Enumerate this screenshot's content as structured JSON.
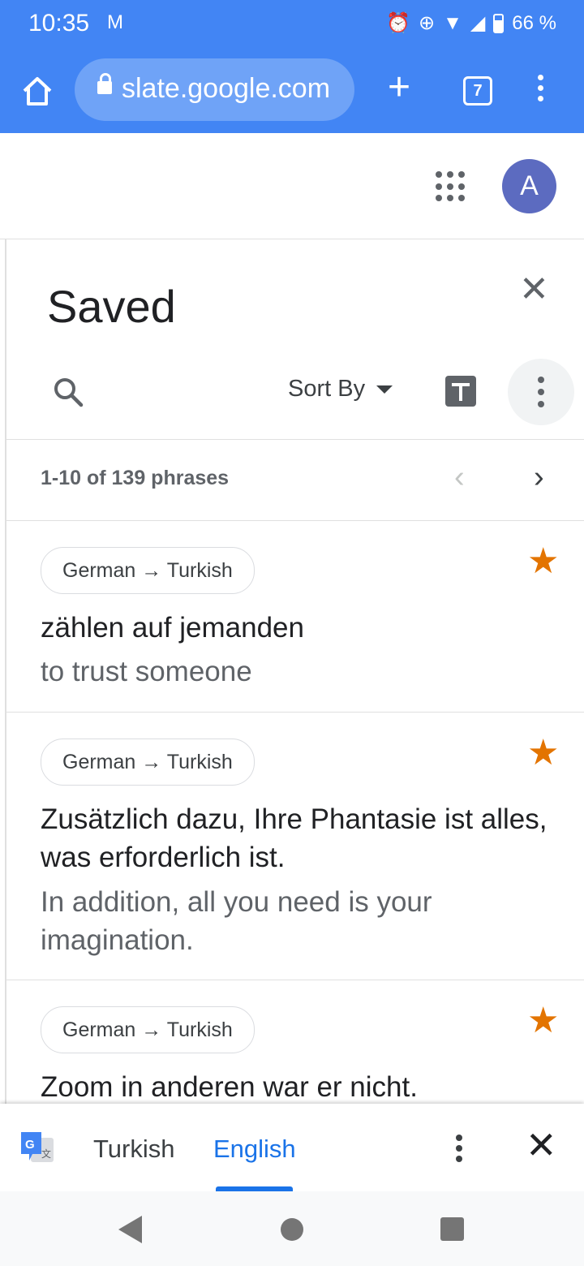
{
  "status_bar": {
    "time": "10:35",
    "mail_icon": "M",
    "battery": "66 %"
  },
  "browser": {
    "url": "slate.google.com",
    "tab_count": "7"
  },
  "header": {
    "avatar_letter": "A"
  },
  "panel": {
    "title": "Saved",
    "sort_label": "Sort By",
    "count_text": "1-10 of 139 phrases"
  },
  "phrases": [
    {
      "lang_pair": "German → Turkish",
      "source": "zählen auf jemanden",
      "target": "to trust someone"
    },
    {
      "lang_pair": "German → Turkish",
      "source": "Zusätzlich dazu, Ihre Phantasie ist alles, was erforderlich ist.",
      "target": "In addition, all you need is your imagination."
    },
    {
      "lang_pair": "German → Turkish",
      "source": "Zoom in anderen war er nicht.",
      "target": ""
    }
  ],
  "translate_bar": {
    "lang_from": "Turkish",
    "lang_to": "English"
  },
  "colors": {
    "browser_blue": "#4285f4",
    "star": "#e37400",
    "accent": "#1a73e8",
    "avatar": "#5c6bc0"
  }
}
